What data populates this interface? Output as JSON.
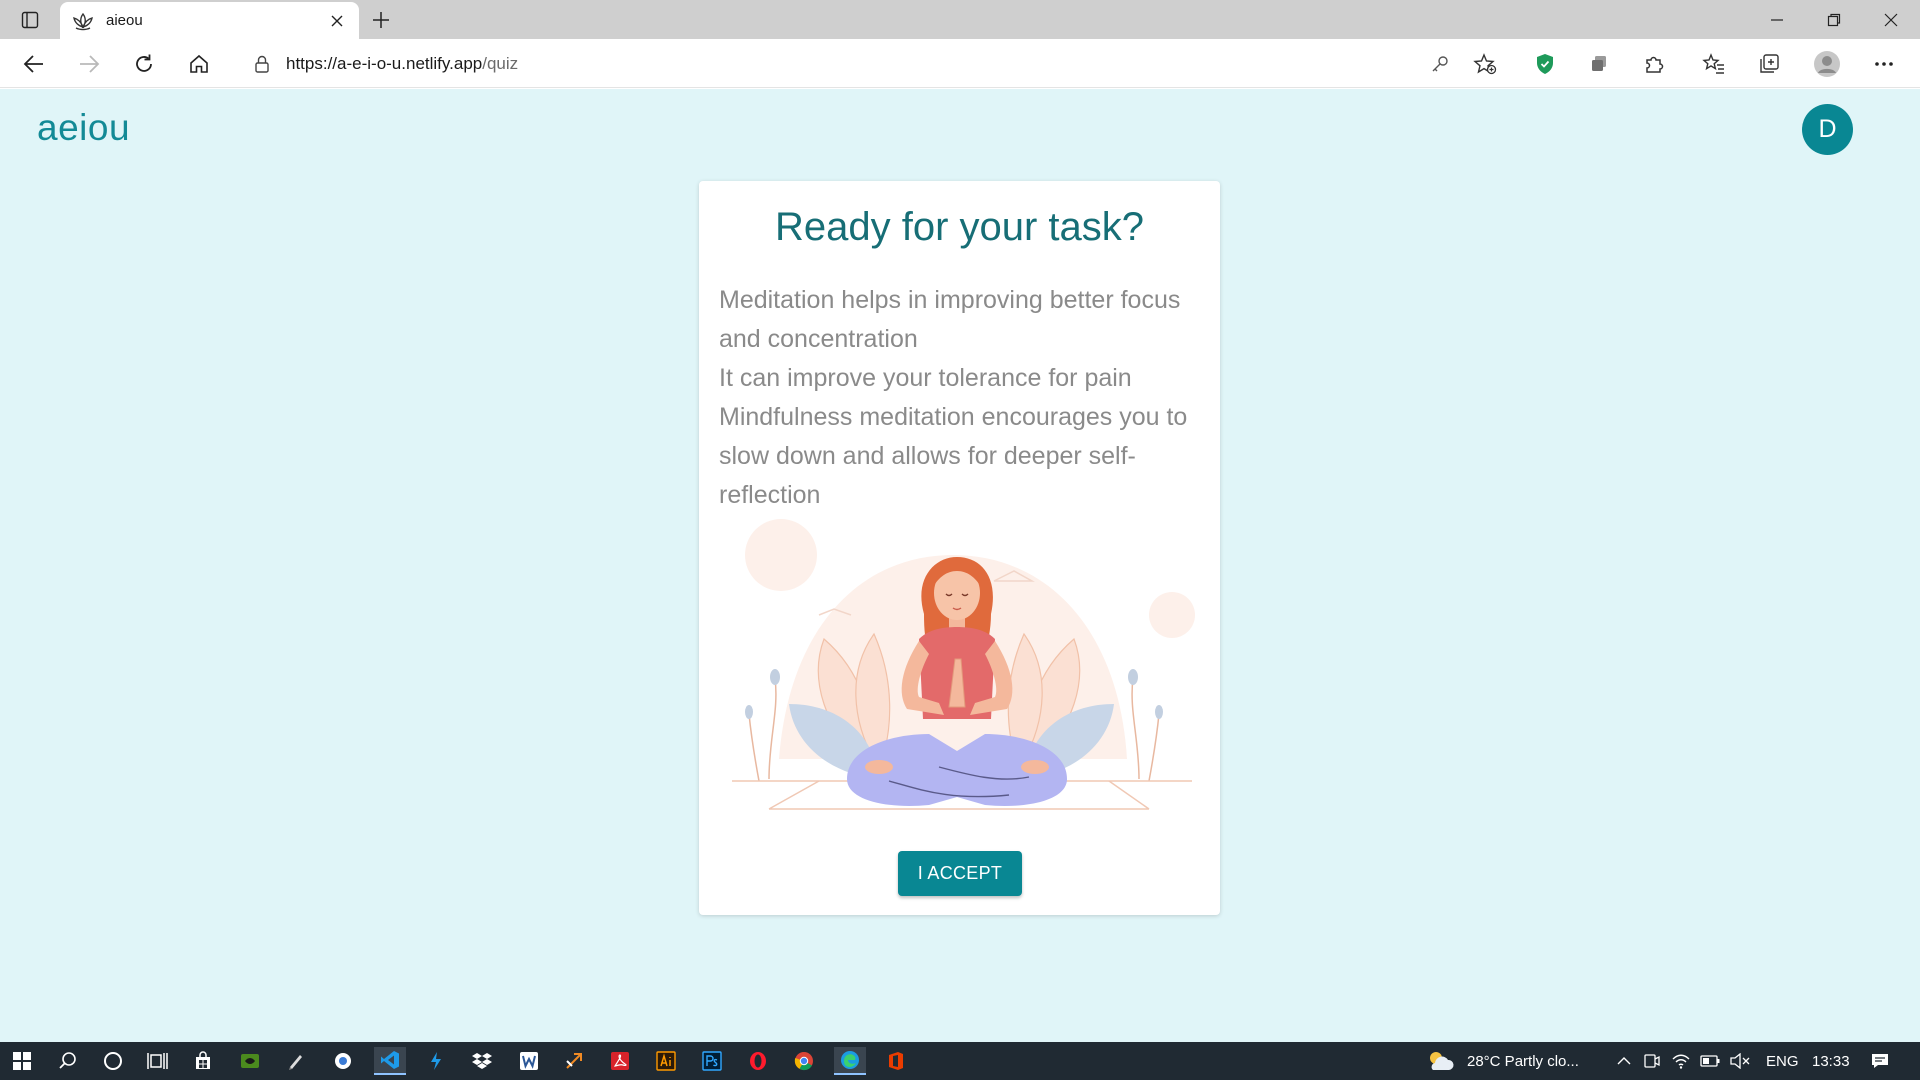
{
  "browser": {
    "tab": {
      "title": "aieou",
      "favicon": "lotus-icon"
    },
    "url_host": "https://a-e-i-o-u.netlify.app",
    "url_path": "/quiz"
  },
  "page": {
    "brand": "aeiou",
    "avatar_initial": "D"
  },
  "card": {
    "title": "Ready for your task?",
    "lines": [
      "Meditation helps in improving better focus and concentration",
      "It can improve your tolerance for pain",
      "Mindfulness meditation encourages you to slow down and allows for deeper self-reflection"
    ],
    "button_label": "I ACCEPT"
  },
  "taskbar": {
    "weather": "28°C  Partly clo...",
    "language": "ENG",
    "time": "13:33"
  },
  "colors": {
    "accent": "#098793",
    "brand_text": "#138a96",
    "title_text": "#176e76",
    "page_bg": "#e0f5f8",
    "body_text": "#8a8a8a"
  }
}
